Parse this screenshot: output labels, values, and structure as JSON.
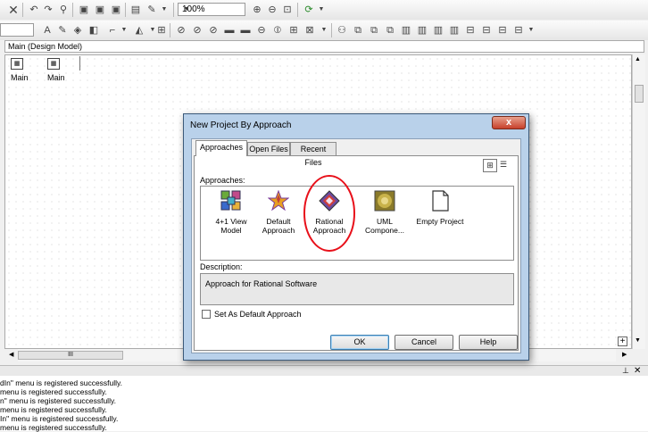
{
  "toolbar": {
    "zoom_value": "100%"
  },
  "document": {
    "title": "Main (Design Model)",
    "tabs": [
      {
        "label": "Main",
        "icon": "diagram-icon"
      },
      {
        "label": "Main",
        "icon": "diagram-icon"
      }
    ]
  },
  "output": {
    "lines": [
      "dIn\" menu is registered successfully.",
      "menu is registered successfully.",
      "n\" menu is registered successfully.",
      "menu is registered successfully.",
      "In\" menu is registered successfully.",
      "menu is registered successfully."
    ]
  },
  "dialog": {
    "title": "New Project By Approach",
    "close_symbol": "x",
    "tabs": [
      "Approaches",
      "Open Files",
      "Recent Files"
    ],
    "approaches_label": "Approaches:",
    "approaches": [
      {
        "label": "4+1 View Model",
        "label_line1": "4+1 View",
        "label_line2": "Model",
        "icon": "grid-squares-icon"
      },
      {
        "label": "Default Approach",
        "label_line1": "Default",
        "label_line2": "Approach",
        "icon": "star-icon"
      },
      {
        "label": "Rational Approach",
        "label_line1": "Rational",
        "label_line2": "Approach",
        "icon": "rational-diamond-icon",
        "selected": true
      },
      {
        "label": "UML Compone...",
        "label_line1": "UML",
        "label_line2": "Compone...",
        "icon": "uml-component-icon"
      },
      {
        "label": "Empty Project",
        "label_line1": "Empty Project",
        "label_line2": "",
        "icon": "blank-page-icon"
      }
    ],
    "description_label": "Description:",
    "description_text": "Approach for Rational Software",
    "default_checkbox_label": "Set As Default Approach",
    "ok_label": "OK",
    "cancel_label": "Cancel",
    "help_label": "Help",
    "highlight_color": "#e8101a"
  },
  "scroll": {
    "hthumb_grip": "III"
  }
}
